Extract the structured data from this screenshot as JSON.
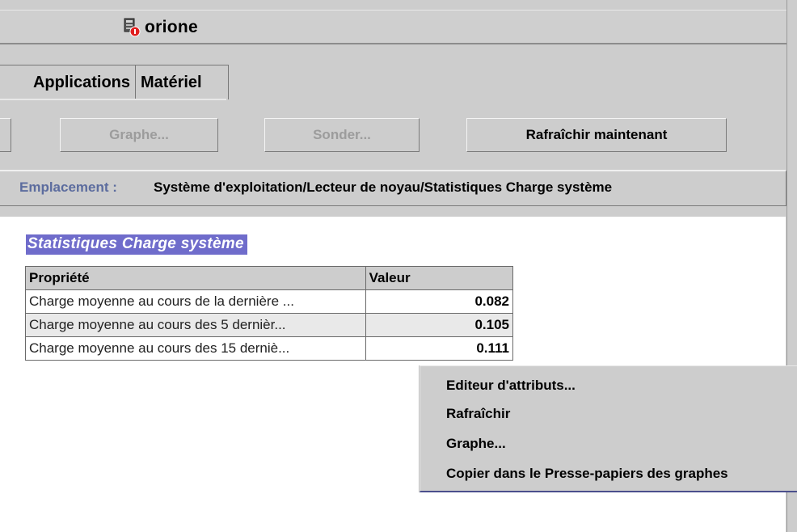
{
  "window": {
    "title": "orione"
  },
  "tabs": [
    {
      "label": "Applications"
    },
    {
      "label": "Matériel"
    }
  ],
  "toolbar": {
    "graph_label": "Graphe...",
    "probe_label": "Sonder...",
    "refresh_label": "Rafraîchir maintenant"
  },
  "location": {
    "label": "Emplacement :",
    "path": "Système d'exploitation/Lecteur de noyau/Statistiques Charge système"
  },
  "table": {
    "title": "Statistiques Charge système",
    "columns": [
      "Propriété",
      "Valeur"
    ],
    "rows": [
      {
        "property": "Charge moyenne au cours de la dernière ...",
        "value": "0.082"
      },
      {
        "property": "Charge moyenne au cours des 5 dernièr...",
        "value": "0.105"
      },
      {
        "property": "Charge moyenne au cours des 15 derniè...",
        "value": "0.111"
      }
    ]
  },
  "context_menu": {
    "items": [
      {
        "label": "Editeur d'attributs..."
      },
      {
        "label": "Rafraîchir"
      },
      {
        "label": "Graphe..."
      },
      {
        "label": "Copier dans le Presse-papiers des graphes"
      }
    ]
  },
  "colors": {
    "background": "#cdcdcd",
    "title_highlight": "#6f6ccb",
    "location_label": "#5c6c9e",
    "status_badge": "#e02020"
  },
  "icons": {
    "window_icon": "server-status-icon"
  }
}
